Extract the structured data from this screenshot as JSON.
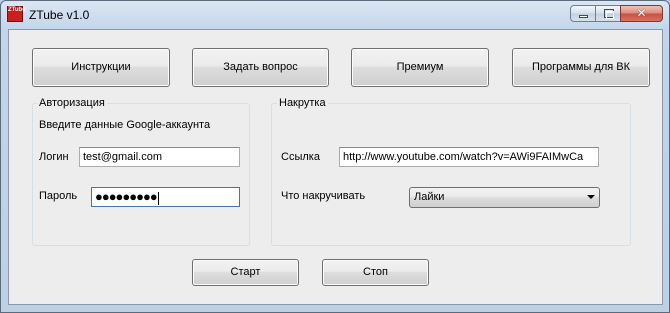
{
  "window": {
    "title": "ZTube v1.0",
    "icon": "ztube-app-icon",
    "icon_text": "ZTube",
    "close_glyph": "✕"
  },
  "toolbar": {
    "instructions_label": "Инструкции",
    "ask_label": "Задать вопрос",
    "premium_label": "Премиум",
    "vk_programs_label": "Программы для ВК"
  },
  "auth": {
    "group_title": "Авторизация",
    "hint": "Введите данные Google-аккаунта",
    "login_label": "Логин",
    "login_value": "test@gmail.com",
    "password_label": "Пароль",
    "password_value": "●●●●●●●●●"
  },
  "boost": {
    "group_title": "Накрутка",
    "link_label": "Ссылка",
    "link_value": "http://www.youtube.com/watch?v=AWi9FAIMwCa",
    "what_label": "Что накручивать",
    "what_selected": "Лайки"
  },
  "actions": {
    "start_label": "Старт",
    "stop_label": "Стоп"
  }
}
